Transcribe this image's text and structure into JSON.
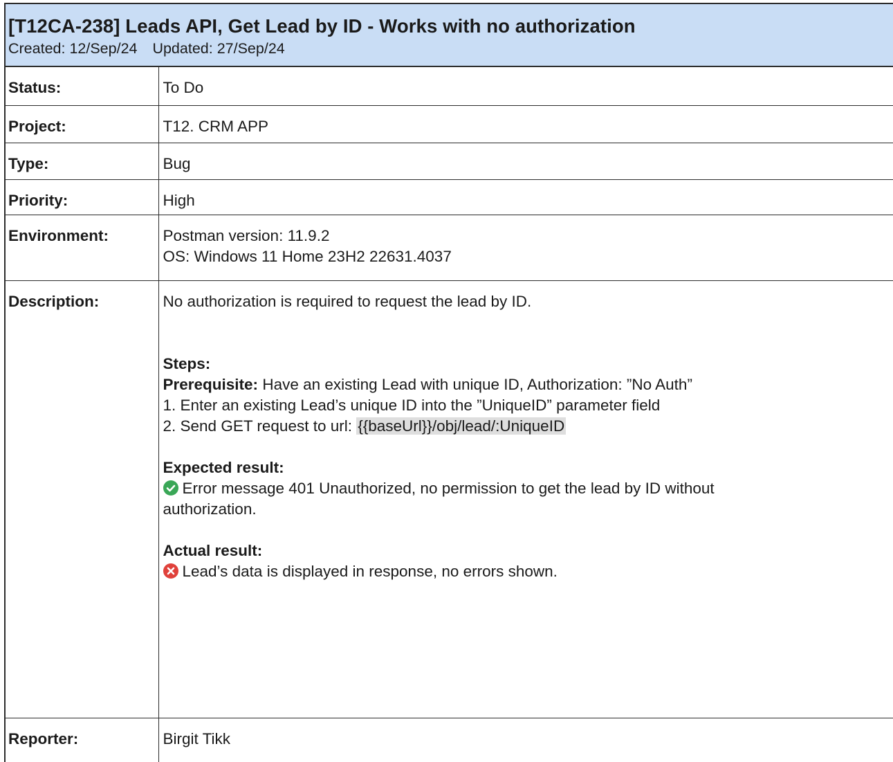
{
  "issue": {
    "title": "[T12CA-238] Leads API, Get Lead by ID - Works with no authorization",
    "created_label": "Created:",
    "created": "12/Sep/24",
    "updated_label": "Updated:",
    "updated": "27/Sep/24"
  },
  "fields": {
    "status_label": "Status:",
    "status": "To Do",
    "project_label": "Project:",
    "project": "T12. CRM APP",
    "type_label": "Type:",
    "type": "Bug",
    "priority_label": "Priority:",
    "priority": "High",
    "environment_label": "Environment:",
    "environment_lines": [
      "Postman version: 11.9.2",
      "OS: Windows 11 Home 23H2 22631.4037"
    ],
    "description_label": "Description:",
    "reporter_label": "Reporter:",
    "reporter": "Birgit Tikk"
  },
  "description": {
    "intro": "No authorization is required to request the lead by ID.",
    "steps_heading": "Steps:",
    "prereq_label": "Prerequisite:",
    "prereq_text": " Have an existing Lead with unique ID, Authorization: ”No Auth”",
    "step1": "1. Enter an existing Lead’s unique ID into the ”UniqueID” parameter field",
    "step2_text": "2. Send GET request to url: ",
    "step2_url": "{{baseUrl}}/obj/lead/:UniqueID",
    "expected_heading": "Expected result:",
    "expected_line1": "Error message 401 Unauthorized, no permission to get the lead by ID without",
    "expected_line2": "authorization.",
    "actual_heading": "Actual result:",
    "actual_text": "Lead’s data is displayed in response, no errors shown.",
    "icons": {
      "expected": "check-circle-icon",
      "actual": "x-circle-icon"
    },
    "colors": {
      "check": "#3aa757",
      "cross": "#e0413b",
      "header_bg": "#c9ddf5",
      "code_bg": "#dedede"
    }
  }
}
